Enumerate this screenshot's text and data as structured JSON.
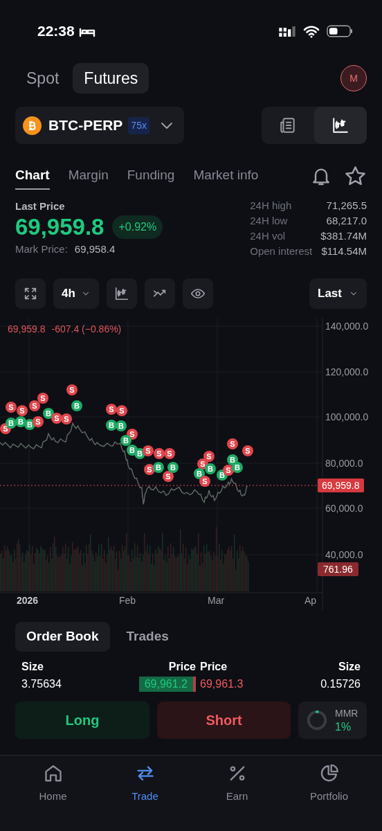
{
  "status_bar": {
    "time": "22:38"
  },
  "market_tabs": [
    {
      "label": "Spot",
      "selected": false
    },
    {
      "label": "Futures",
      "selected": true
    }
  ],
  "avatar": {
    "initial": "M"
  },
  "pair": {
    "symbol": "BTC-PERP",
    "leverage": "75x"
  },
  "view_toggle": [
    {
      "kind": "news",
      "selected": false
    },
    {
      "kind": "chart",
      "selected": true
    }
  ],
  "section_tabs": [
    {
      "label": "Chart",
      "selected": true
    },
    {
      "label": "Margin",
      "selected": false
    },
    {
      "label": "Funding",
      "selected": false
    },
    {
      "label": "Market info",
      "selected": false
    }
  ],
  "price": {
    "label": "Last Price",
    "value": "69,959.8",
    "change": "+0.92%",
    "mark_label": "Mark Price:",
    "mark_value": "69,958.4"
  },
  "stats": [
    {
      "label": "24H high",
      "value": "71,265.5"
    },
    {
      "label": "24H low",
      "value": "68,217.0"
    },
    {
      "label": "24H vol",
      "value": "$381.74M"
    },
    {
      "label": "Open interest",
      "value": "$114.54M"
    }
  ],
  "chart_toolbar": {
    "interval": "4h",
    "price_type": "Last"
  },
  "chart": {
    "legend_price": "69,959.8",
    "legend_change": "-607.4 (−0.86%)",
    "price_ticks": [
      "140,000.0",
      "120,000.0",
      "100,000.0",
      "80,000.0",
      "60,000.0",
      "40,000.0"
    ],
    "time_labels": [
      "2026",
      "Feb",
      "Mar",
      "Ap"
    ],
    "last_price_tag": "69,959.8",
    "volume_tag": "761.96",
    "markers": [
      {
        "kind": "sell",
        "label": "S"
      },
      {
        "kind": "sell",
        "label": "S"
      },
      {
        "kind": "sell",
        "label": "S"
      },
      {
        "kind": "sell",
        "label": "S"
      },
      {
        "kind": "sell",
        "label": "S"
      },
      {
        "kind": "buy",
        "label": "B"
      },
      {
        "kind": "sell",
        "label": "S"
      },
      {
        "kind": "buy",
        "label": "B"
      },
      {
        "kind": "buy",
        "label": "B"
      },
      {
        "kind": "buy",
        "label": "B"
      },
      {
        "kind": "sell",
        "label": "S"
      },
      {
        "kind": "buy",
        "label": "B"
      },
      {
        "kind": "sell",
        "label": "S"
      },
      {
        "kind": "sell",
        "label": "S"
      },
      {
        "kind": "sell",
        "label": "S"
      },
      {
        "kind": "sell",
        "label": "S"
      },
      {
        "kind": "buy",
        "label": "B"
      },
      {
        "kind": "buy",
        "label": "B"
      },
      {
        "kind": "sell",
        "label": "S"
      },
      {
        "kind": "buy",
        "label": "B"
      },
      {
        "kind": "buy",
        "label": "B"
      },
      {
        "kind": "buy",
        "label": "B"
      },
      {
        "kind": "sell",
        "label": "S"
      },
      {
        "kind": "sell",
        "label": "S"
      },
      {
        "kind": "sell",
        "label": "S"
      },
      {
        "kind": "sell",
        "label": "S"
      },
      {
        "kind": "buy",
        "label": "B"
      },
      {
        "kind": "sell",
        "label": "S"
      },
      {
        "kind": "sell",
        "label": "S"
      },
      {
        "kind": "buy",
        "label": "B"
      },
      {
        "kind": "sell",
        "label": "S"
      },
      {
        "kind": "buy",
        "label": "B"
      },
      {
        "kind": "sell",
        "label": "S"
      },
      {
        "kind": "buy",
        "label": "B"
      },
      {
        "kind": "buy",
        "label": "B"
      },
      {
        "kind": "buy",
        "label": "B"
      },
      {
        "kind": "sell",
        "label": "S"
      },
      {
        "kind": "sell",
        "label": "S"
      },
      {
        "kind": "buy",
        "label": "B"
      },
      {
        "kind": "sell",
        "label": "S"
      }
    ]
  },
  "order_book": {
    "tabs": [
      {
        "label": "Order Book",
        "selected": true
      },
      {
        "label": "Trades",
        "selected": false
      }
    ],
    "columns": [
      "Size",
      "Price",
      "Price",
      "Size"
    ],
    "rows": [
      {
        "bid_size": "3.75634",
        "bid_price": "69,961.2",
        "ask_price": "69,961.3",
        "ask_size": "0.15726"
      }
    ]
  },
  "actions": {
    "long": "Long",
    "short": "Short",
    "mmr_label": "MMR",
    "mmr_value": "1%",
    "level": 0.01
  },
  "nav": [
    {
      "kind": "home",
      "label": "Home",
      "selected": false
    },
    {
      "kind": "trade",
      "label": "Trade",
      "selected": true
    },
    {
      "kind": "earn",
      "label": "Earn",
      "selected": false
    },
    {
      "kind": "portfolio",
      "label": "Portfolio",
      "selected": false
    }
  ]
}
